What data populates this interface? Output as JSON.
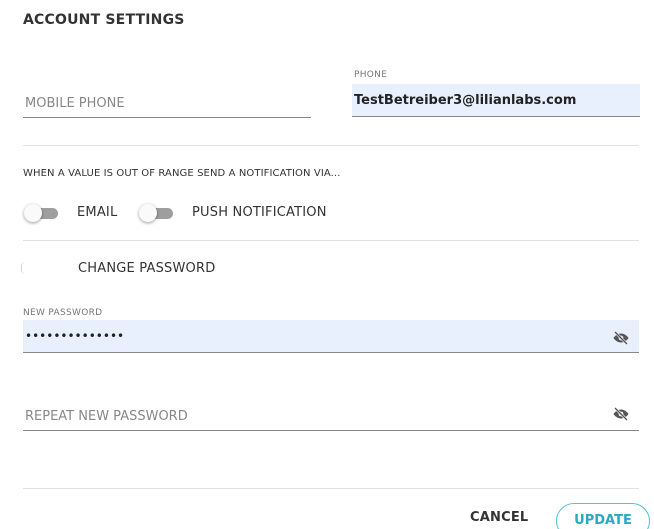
{
  "dialog": {
    "title": "ACCOUNT SETTINGS"
  },
  "contact": {
    "mobile_phone_placeholder": "MOBILE PHONE",
    "phone_label": "PHONE",
    "phone_value": "TestBetreiber3@lilianlabs.com"
  },
  "notifications": {
    "text": "WHEN A VALUE IS OUT OF RANGE SEND A NOTIFICATION VIA...",
    "email_label": "EMAIL",
    "email_enabled": false,
    "push_label": "PUSH NOTIFICATION",
    "push_enabled": false
  },
  "password": {
    "change_label": "CHANGE PASSWORD",
    "new_label": "NEW PASSWORD",
    "new_value": "••••••••••••••",
    "repeat_placeholder": "REPEAT NEW PASSWORD"
  },
  "footer": {
    "cancel_label": "CANCEL",
    "update_label": "UPDATE"
  },
  "colors": {
    "accent": "#4fc3d9",
    "autofill_bg": "#e8f0fe"
  },
  "icons": {
    "visibility_toggle": "eye-off-icon"
  }
}
